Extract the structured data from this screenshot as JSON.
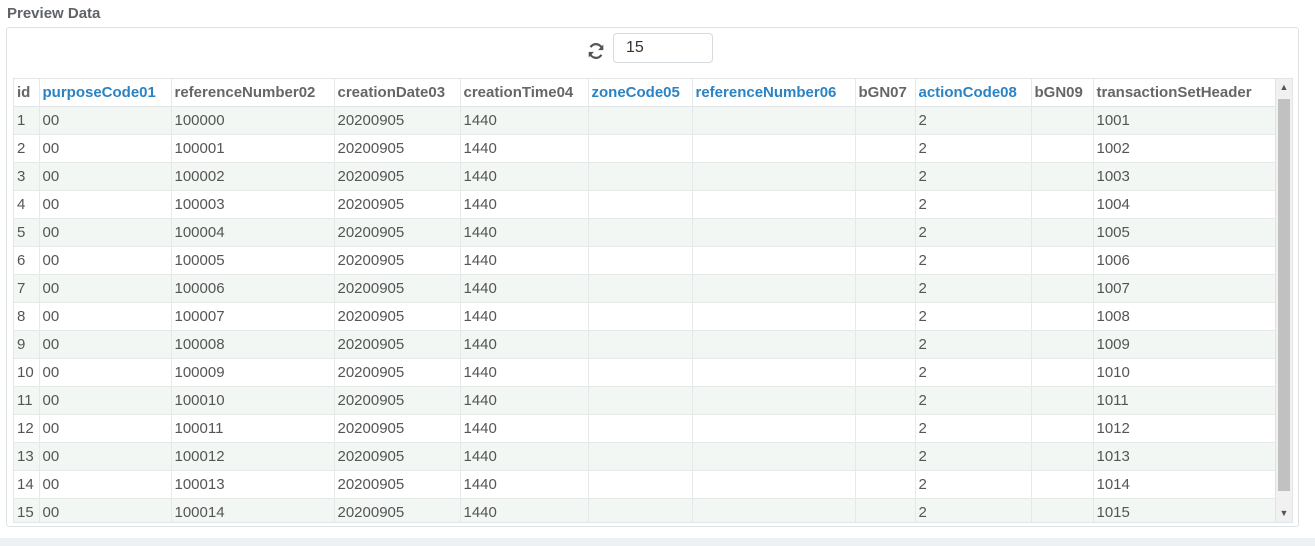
{
  "section_title": "Preview Data",
  "toolbar": {
    "refresh_icon": "refresh-icon",
    "rows_value": "15"
  },
  "grid": {
    "columns": [
      {
        "label": "id",
        "linked": false
      },
      {
        "label": "purposeCode01",
        "linked": true
      },
      {
        "label": "referenceNumber02",
        "linked": false
      },
      {
        "label": "creationDate03",
        "linked": false
      },
      {
        "label": "creationTime04",
        "linked": false
      },
      {
        "label": "zoneCode05",
        "linked": true
      },
      {
        "label": "referenceNumber06",
        "linked": true
      },
      {
        "label": "bGN07",
        "linked": false
      },
      {
        "label": "actionCode08",
        "linked": true
      },
      {
        "label": "bGN09",
        "linked": false
      },
      {
        "label": "transactionSetHeader",
        "linked": false
      }
    ],
    "rows": [
      [
        "1",
        "00",
        "100000",
        "20200905",
        "1440",
        "",
        "",
        "",
        "2",
        "",
        "1001"
      ],
      [
        "2",
        "00",
        "100001",
        "20200905",
        "1440",
        "",
        "",
        "",
        "2",
        "",
        "1002"
      ],
      [
        "3",
        "00",
        "100002",
        "20200905",
        "1440",
        "",
        "",
        "",
        "2",
        "",
        "1003"
      ],
      [
        "4",
        "00",
        "100003",
        "20200905",
        "1440",
        "",
        "",
        "",
        "2",
        "",
        "1004"
      ],
      [
        "5",
        "00",
        "100004",
        "20200905",
        "1440",
        "",
        "",
        "",
        "2",
        "",
        "1005"
      ],
      [
        "6",
        "00",
        "100005",
        "20200905",
        "1440",
        "",
        "",
        "",
        "2",
        "",
        "1006"
      ],
      [
        "7",
        "00",
        "100006",
        "20200905",
        "1440",
        "",
        "",
        "",
        "2",
        "",
        "1007"
      ],
      [
        "8",
        "00",
        "100007",
        "20200905",
        "1440",
        "",
        "",
        "",
        "2",
        "",
        "1008"
      ],
      [
        "9",
        "00",
        "100008",
        "20200905",
        "1440",
        "",
        "",
        "",
        "2",
        "",
        "1009"
      ],
      [
        "10",
        "00",
        "100009",
        "20200905",
        "1440",
        "",
        "",
        "",
        "2",
        "",
        "1010"
      ],
      [
        "11",
        "00",
        "100010",
        "20200905",
        "1440",
        "",
        "",
        "",
        "2",
        "",
        "1011"
      ],
      [
        "12",
        "00",
        "100011",
        "20200905",
        "1440",
        "",
        "",
        "",
        "2",
        "",
        "1012"
      ],
      [
        "13",
        "00",
        "100012",
        "20200905",
        "1440",
        "",
        "",
        "",
        "2",
        "",
        "1013"
      ],
      [
        "14",
        "00",
        "100013",
        "20200905",
        "1440",
        "",
        "",
        "",
        "2",
        "",
        "1014"
      ],
      [
        "15",
        "00",
        "100014",
        "20200905",
        "1440",
        "",
        "",
        "",
        "2",
        "",
        "1015"
      ]
    ]
  },
  "colors": {
    "linked_header": "#2a83c3",
    "odd_row": "#f2f7f4"
  }
}
